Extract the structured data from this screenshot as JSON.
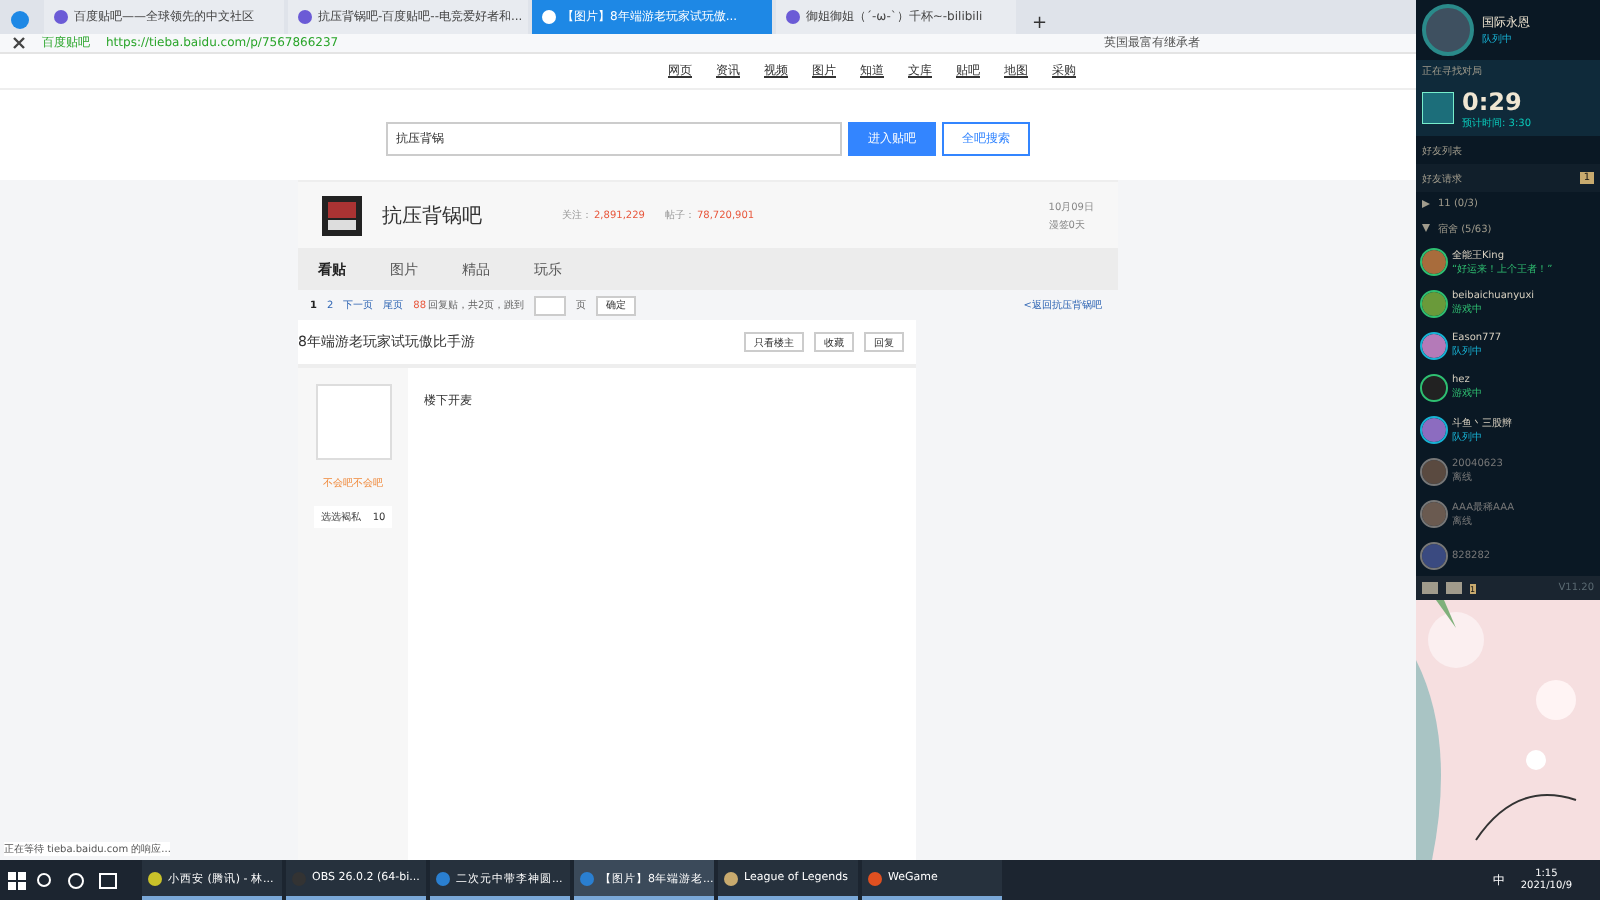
{
  "browser": {
    "tabs": [
      {
        "title": "百度贴吧——全球领先的中文社区",
        "selected": false
      },
      {
        "title": "抗压背锅吧-百度贴吧--电竞爱好者和...",
        "selected": false
      },
      {
        "title": "【图片】8年端游老玩家试玩傲...",
        "selected": true
      },
      {
        "title": "御姐御姐（´-ω-`）千杯~-bilibili",
        "selected": false
      }
    ],
    "new_tab": "+",
    "site_name": "百度贴吧",
    "url": "https://tieba.baidu.com/p/7567866237",
    "search_placeholder": "英国最富有继承者",
    "status_text": "正在等待 tieba.baidu.com 的响应..."
  },
  "page": {
    "nav": [
      "网页",
      "资讯",
      "视频",
      "图片",
      "知道",
      "文库",
      "贴吧",
      "地图",
      "采购"
    ],
    "search": {
      "value": "抗压背锅",
      "enter_button": "进入贴吧",
      "search_button": "全吧搜索"
    },
    "forum": {
      "name": "抗压背锅吧",
      "follow_label": "关注：",
      "follow_count": "2,891,229",
      "posts_label": "帖子：",
      "posts_count": "78,720,901",
      "date": "10月09日",
      "sign": "漫签0天"
    },
    "tabs": [
      {
        "label": "看贴",
        "selected": true
      },
      {
        "label": "图片",
        "selected": false
      },
      {
        "label": "精品",
        "selected": false
      },
      {
        "label": "玩乐",
        "selected": false
      }
    ],
    "pager": {
      "pages": [
        {
          "label": "1",
          "selected": true
        },
        {
          "label": "2",
          "selected": false
        }
      ],
      "next": "下一页",
      "last": "尾页",
      "replies": "88",
      "summary": "回复贴，共2页，跳到",
      "page_unit": "页",
      "go": "确定",
      "back": "<返回抗压背锅吧"
    },
    "post": {
      "title": "8年端游老玩家试玩傲比手游",
      "buttons": [
        "只看楼主",
        "收藏",
        "回复"
      ],
      "author": "不会吧不会吧",
      "badge": "选选褐私",
      "level": "10",
      "body": "楼下开麦"
    }
  },
  "client": {
    "name": "国际永恩",
    "status": "队列中",
    "queue_title": "正在寻找对局",
    "timer": "0:29",
    "estimate": "预计时间: 3:30",
    "friends_title": "好友列表",
    "requests": "好友请求",
    "requests_count": "1",
    "groups": [
      {
        "label": "11 (0/3)",
        "expanded": false
      },
      {
        "label": "宿舍 (5/63)",
        "expanded": true
      }
    ],
    "friends": [
      {
        "name": "全能王King",
        "status": "“好运来！上个王者！”",
        "kind": "message"
      },
      {
        "name": "beibaichuanyuxi",
        "status": "游戏中",
        "kind": "ingame"
      },
      {
        "name": "Eason777",
        "status": "队列中",
        "kind": "queue"
      },
      {
        "name": "hez",
        "status": "游戏中",
        "kind": "ingame"
      },
      {
        "name": "斗鱼丶三股辫",
        "status": "队列中",
        "kind": "queue"
      },
      {
        "name": "20040623",
        "status": "离线",
        "kind": "offline"
      },
      {
        "name": "AAA最稀AAA",
        "status": "离线",
        "kind": "offline"
      },
      {
        "name": "828282",
        "kind": "offline"
      }
    ],
    "mail_count": "1",
    "version": "V11.20"
  },
  "taskbar": {
    "apps": [
      {
        "label": "小西安 (腾讯) - 林...",
        "selected": false
      },
      {
        "label": "OBS 26.0.2 (64-bi...",
        "selected": false
      },
      {
        "label": "二次元中带李神圆...",
        "selected": false
      },
      {
        "label": "【图片】8年端游老...",
        "selected": true
      },
      {
        "label": "League of Legends",
        "selected": false
      },
      {
        "label": "WeGame",
        "selected": false
      }
    ],
    "ime": "中",
    "time": "1:15",
    "date": "2021/10/9"
  }
}
